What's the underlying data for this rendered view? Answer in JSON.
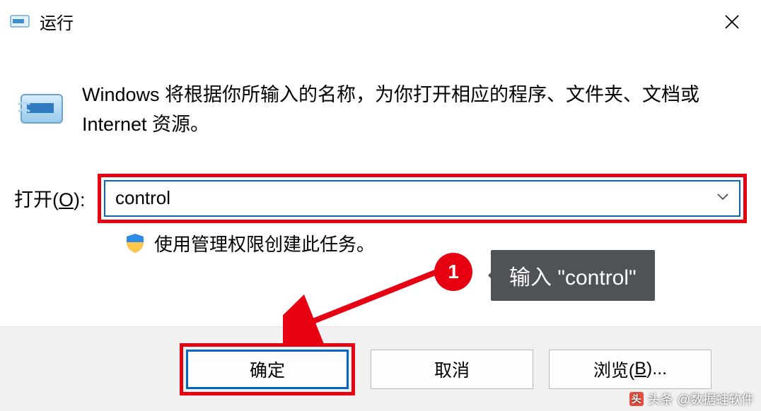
{
  "titlebar": {
    "title": "运行"
  },
  "body": {
    "description": "Windows 将根据你所输入的名称，为你打开相应的程序、文件夹、文档或 Internet 资源。",
    "open_label_prefix": "打开(",
    "open_label_key": "O",
    "open_label_suffix": "):",
    "input_value": "control",
    "admin_text": "使用管理权限创建此任务。"
  },
  "buttons": {
    "ok": "确定",
    "cancel": "取消",
    "browse_prefix": "浏览(",
    "browse_key": "B",
    "browse_suffix": ")..."
  },
  "annotation": {
    "marker": "1",
    "tooltip": "输入 \"control\""
  },
  "watermark": {
    "source": "头条",
    "author": "@数据蛙软件"
  }
}
